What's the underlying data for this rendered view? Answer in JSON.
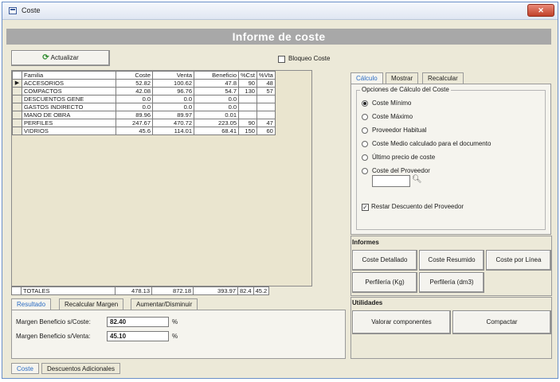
{
  "window": {
    "title": "Coste",
    "close": "✕"
  },
  "banner": "Informe de coste",
  "toolbar": {
    "refresh_icon": "refresh-icon",
    "refresh_label": "Actualizar",
    "lock_label": "Bloqueo Coste",
    "lock_checked": false
  },
  "grid": {
    "columns": [
      "Familia",
      "Coste",
      "Venta",
      "Beneficio",
      "%Cst",
      "%Vta"
    ],
    "rows": [
      [
        "ACCESORIOS",
        "52.82",
        "100.62",
        "47.8",
        "90",
        "48"
      ],
      [
        "COMPACTOS",
        "42.08",
        "96.76",
        "54.7",
        "130",
        "57"
      ],
      [
        "DESCUENTOS GENE",
        "0.0",
        "0.0",
        "0.0",
        "",
        ""
      ],
      [
        "GASTOS INDIRECTO",
        "0.0",
        "0.0",
        "0.0",
        "",
        ""
      ],
      [
        "MANO DE OBRA",
        "89.96",
        "89.97",
        "0.01",
        "",
        ""
      ],
      [
        "PERFILES",
        "247.67",
        "470.72",
        "223.05",
        "90",
        "47"
      ],
      [
        "VIDRIOS",
        "45.6",
        "114.01",
        "68.41",
        "150",
        "60"
      ]
    ],
    "selected_marker": "▶",
    "totals": [
      "TOTALES",
      "478.13",
      "872.18",
      "393.97",
      "82.4",
      "45.2"
    ]
  },
  "bottom_left": {
    "tabs": [
      "Resultado",
      "Recalcular Margen",
      "Aumentar/Disminuir"
    ],
    "margin_cost_label": "Margen Beneficio s/Coste:",
    "margin_cost_value": "82.40",
    "margin_sale_label": "Margen Beneficio s/Venta:",
    "margin_sale_value": "45.10",
    "pct": "%"
  },
  "right": {
    "tabs": [
      "Cálculo",
      "Mostrar",
      "Recalcular"
    ],
    "group_title": "Opciones de Cálculo del Coste",
    "options": [
      "Coste Mínimo",
      "Coste Máximo",
      "Proveedor Habitual",
      "Coste Medio calculado para el documento",
      "Último precio de coste",
      "Coste del Proveedor"
    ],
    "selected_option": 0,
    "discount_label": "Restar Descuento del Proveedor",
    "discount_checked": true
  },
  "informes": {
    "title": "Informes",
    "buttons": [
      "Coste Detallado",
      "Coste Resumido",
      "Coste por Línea",
      "Perfilería (Kg)",
      "Perfilería (dm3)"
    ]
  },
  "utilidades": {
    "title": "Utilidades",
    "buttons": [
      "Valorar componentes",
      "Compactar"
    ]
  },
  "bottom_tabs": [
    "Coste",
    "Descuentos Adicionales"
  ]
}
